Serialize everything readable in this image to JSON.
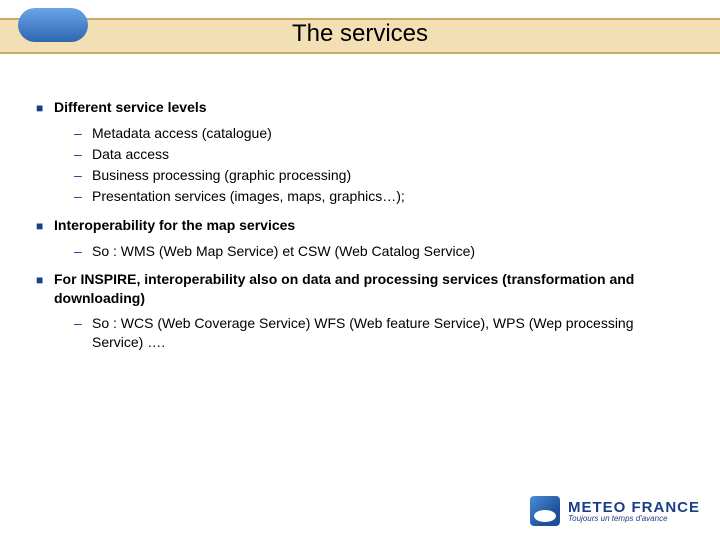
{
  "title": "The services",
  "sections": [
    {
      "heading": "Different service levels",
      "items": [
        "Metadata access (catalogue)",
        "Data access",
        "Business processing (graphic processing)",
        "Presentation services (images, maps, graphics…);"
      ]
    },
    {
      "heading": "Interoperability for the map services",
      "items": [
        "So : WMS (Web Map Service) et CSW (Web Catalog Service)"
      ]
    },
    {
      "heading": "For INSPIRE, interoperability also on data and processing services (transformation and downloading)",
      "items": [
        "So : WCS (Web Coverage Service)  WFS (Web feature Service), WPS (Wep processing Service) …."
      ]
    }
  ],
  "logo": {
    "name": "METEO FRANCE",
    "tagline": "Toujours un temps d'avance"
  }
}
